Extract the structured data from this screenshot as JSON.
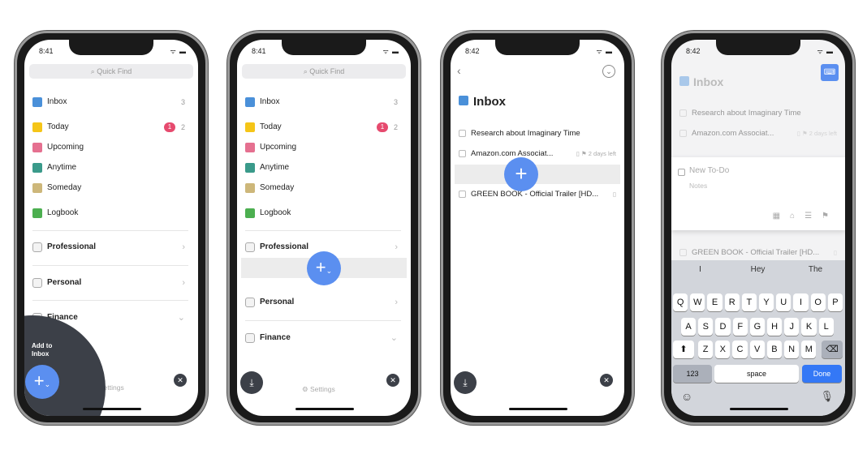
{
  "colors": {
    "accent": "#5b8ff0",
    "badge": "#e64a6e",
    "dark": "#3c4048"
  },
  "phone1": {
    "time": "8:41",
    "quick_find": "Quick Find",
    "add_to_inbox": "Add to Inbox",
    "settings": "Settings"
  },
  "phone2": {
    "time": "8:41",
    "quick_find": "Quick Find",
    "settings": "Settings"
  },
  "sidebar": {
    "items": [
      {
        "label": "Inbox",
        "icon": "inbox-icon",
        "color": "#4a90d9",
        "count": "3"
      },
      {
        "label": "Today",
        "icon": "star-icon",
        "color": "#f5c518",
        "badge": "1",
        "count": "2"
      },
      {
        "label": "Upcoming",
        "icon": "calendar-icon",
        "color": "#e57090"
      },
      {
        "label": "Anytime",
        "icon": "layers-icon",
        "color": "#3a9a8a"
      },
      {
        "label": "Someday",
        "icon": "archive-box-icon",
        "color": "#cdb77a"
      },
      {
        "label": "Logbook",
        "icon": "logbook-icon",
        "color": "#4caf50"
      }
    ],
    "areas": [
      {
        "label": "Professional",
        "chevron": "›"
      },
      {
        "label": "Personal",
        "chevron": "›"
      },
      {
        "label": "Finance",
        "chevron": "⌄"
      }
    ]
  },
  "phone3": {
    "time": "8:42",
    "title": "Inbox",
    "todos": [
      {
        "text": "Research about Imaginary Time",
        "meta": ""
      },
      {
        "text": "Amazon.com Associat...",
        "meta": "▯ ⚑ 2 days left"
      },
      {
        "text": "GREEN BOOK - Official Trailer [HD...",
        "meta": "▯"
      }
    ]
  },
  "phone4": {
    "time": "8:42",
    "title": "Inbox",
    "new_todo_placeholder": "New To-Do",
    "notes_placeholder": "Notes",
    "suggestions": [
      "I",
      "Hey",
      "The"
    ],
    "keys": {
      "row1": [
        "Q",
        "W",
        "E",
        "R",
        "T",
        "Y",
        "U",
        "I",
        "O",
        "P"
      ],
      "row2": [
        "A",
        "S",
        "D",
        "F",
        "G",
        "H",
        "J",
        "K",
        "L"
      ],
      "row3": [
        "Z",
        "X",
        "C",
        "V",
        "B",
        "N",
        "M"
      ],
      "numbers": "123",
      "space": "space",
      "done": "Done"
    }
  }
}
